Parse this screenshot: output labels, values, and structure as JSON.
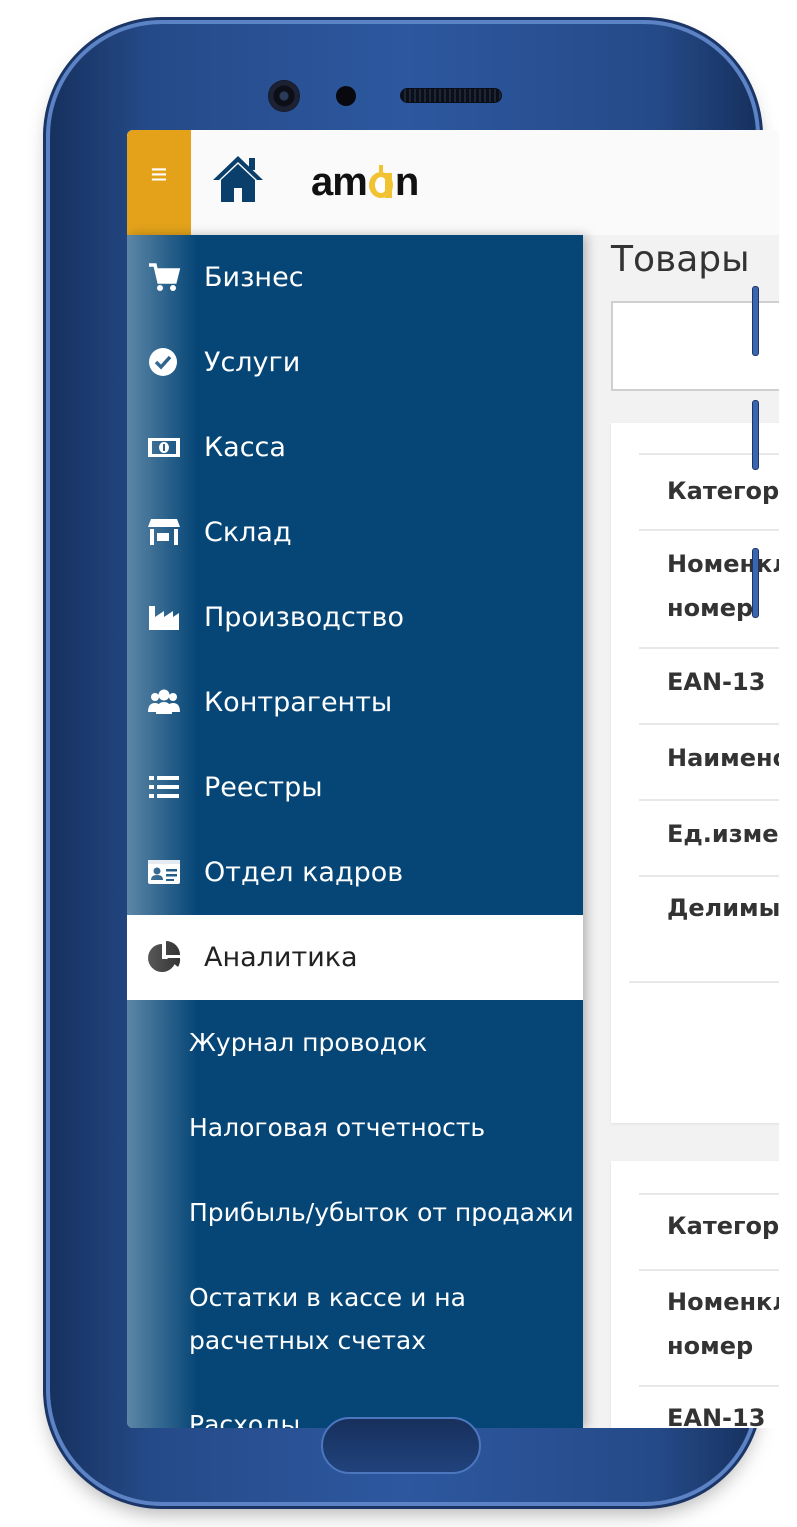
{
  "app": {
    "logo_left": "am",
    "logo_right": "n"
  },
  "colors": {
    "sidebar": "#064677",
    "accent": "#e3a21a",
    "home_icon": "#0a3f6b"
  },
  "topbar": {
    "menu_icon": "≡"
  },
  "sidebar": {
    "items": [
      {
        "label": "Бизнес",
        "icon": "cart-icon"
      },
      {
        "label": "Услуги",
        "icon": "check-circle-icon"
      },
      {
        "label": "Касса",
        "icon": "banknote-icon"
      },
      {
        "label": "Склад",
        "icon": "warehouse-icon"
      },
      {
        "label": "Производство",
        "icon": "factory-icon"
      },
      {
        "label": "Контрагенты",
        "icon": "users-icon"
      },
      {
        "label": "Реестры",
        "icon": "list-icon"
      },
      {
        "label": "Отдел кадров",
        "icon": "id-card-icon"
      },
      {
        "label": "Аналитика",
        "icon": "pie-chart-icon",
        "active": true
      }
    ],
    "sub_items": [
      {
        "label": "Журнал проводок"
      },
      {
        "label": "Налоговая отчетность"
      },
      {
        "label": "Прибыль/убыток от продажи"
      },
      {
        "label": "Остатки в кассе и на расчетных счетах"
      },
      {
        "label": "Расходы"
      }
    ]
  },
  "main": {
    "title": "Товары",
    "card1_rows": [
      "Категори",
      "Номенкл",
      "номер",
      "EAN-13",
      "Наимено",
      "Ед.измер",
      "Делимый"
    ],
    "card2_rows": [
      "Категори",
      "Номенкл",
      "номер",
      "EAN-13"
    ]
  }
}
